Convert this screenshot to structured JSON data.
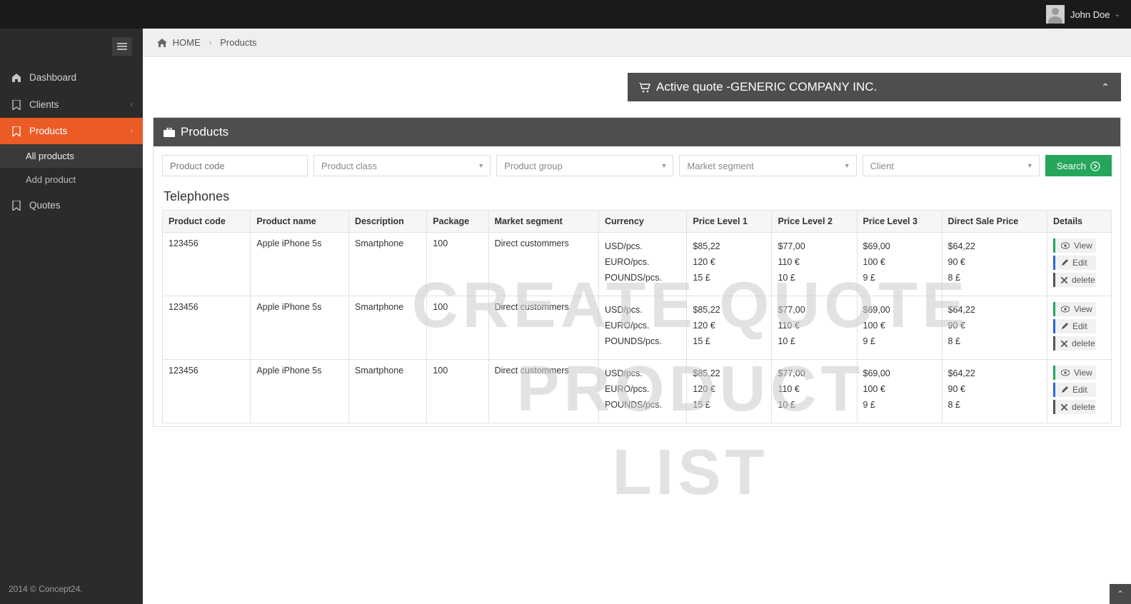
{
  "topbar": {
    "user_name": "John Doe"
  },
  "sidebar": {
    "items": [
      {
        "label": "Dashboard"
      },
      {
        "label": "Clients"
      },
      {
        "label": "Products"
      },
      {
        "label": "Quotes"
      }
    ],
    "products_sub": [
      {
        "label": "All products"
      },
      {
        "label": "Add product"
      }
    ]
  },
  "footer": {
    "text": "2014 © Concept24."
  },
  "breadcrumb": {
    "home": "HOME",
    "current": "Products"
  },
  "active_quote": {
    "prefix": "Active quote - ",
    "company": "GENERIC COMPANY INC."
  },
  "panel": {
    "title": "Products"
  },
  "filters": {
    "product_code_placeholder": "Product code",
    "product_class_placeholder": "Product class",
    "product_group_placeholder": "Product group",
    "market_segment_placeholder": "Market segment",
    "client_placeholder": "Client",
    "search_label": "Search"
  },
  "section_title": "Telephones",
  "columns": {
    "code": "Product code",
    "name": "Product name",
    "desc": "Description",
    "package": "Package",
    "segment": "Market segment",
    "currency": "Currency",
    "pl1": "Price Level 1",
    "pl2": "Price Level 2",
    "pl3": "Price Level 3",
    "dsp": "Direct Sale Price",
    "details": "Details"
  },
  "action_labels": {
    "view": "View",
    "edit": "Edit",
    "delete": "delete"
  },
  "rows": [
    {
      "code": "123456",
      "name": "Apple iPhone 5s",
      "desc": "Smartphone",
      "package": "100",
      "segment": "Direct custommers",
      "currencies": [
        "USD/pcs.",
        "EURO/pcs.",
        "POUNDS/pcs."
      ],
      "pl1": [
        "$85,22",
        "120 €",
        "15 £"
      ],
      "pl2": [
        "$77,00",
        "110 €",
        "10 £"
      ],
      "pl3": [
        "$69,00",
        "100 €",
        "9 £"
      ],
      "dsp": [
        "$64,22",
        "90 €",
        "8 £"
      ]
    },
    {
      "code": "123456",
      "name": "Apple iPhone 5s",
      "desc": "Smartphone",
      "package": "100",
      "segment": "Direct custommers",
      "currencies": [
        "USD/pcs.",
        "EURO/pcs.",
        "POUNDS/pcs."
      ],
      "pl1": [
        "$85,22",
        "120 €",
        "15 £"
      ],
      "pl2": [
        "$77,00",
        "110 €",
        "10 £"
      ],
      "pl3": [
        "$69,00",
        "100 €",
        "9 £"
      ],
      "dsp": [
        "$64,22",
        "90 €",
        "8 £"
      ]
    },
    {
      "code": "123456",
      "name": "Apple iPhone 5s",
      "desc": "Smartphone",
      "package": "100",
      "segment": "Direct custommers",
      "currencies": [
        "USD/pcs.",
        "EURO/pcs.",
        "POUNDS/pcs."
      ],
      "pl1": [
        "$85,22",
        "120 €",
        "15 £"
      ],
      "pl2": [
        "$77,00",
        "110 €",
        "10 £"
      ],
      "pl3": [
        "$69,00",
        "100 €",
        "9 £"
      ],
      "dsp": [
        "$64,22",
        "90 €",
        "8 £"
      ]
    }
  ],
  "watermark": {
    "line1": "CREATE QUOTE PRODUCT",
    "line2": "LIST"
  }
}
